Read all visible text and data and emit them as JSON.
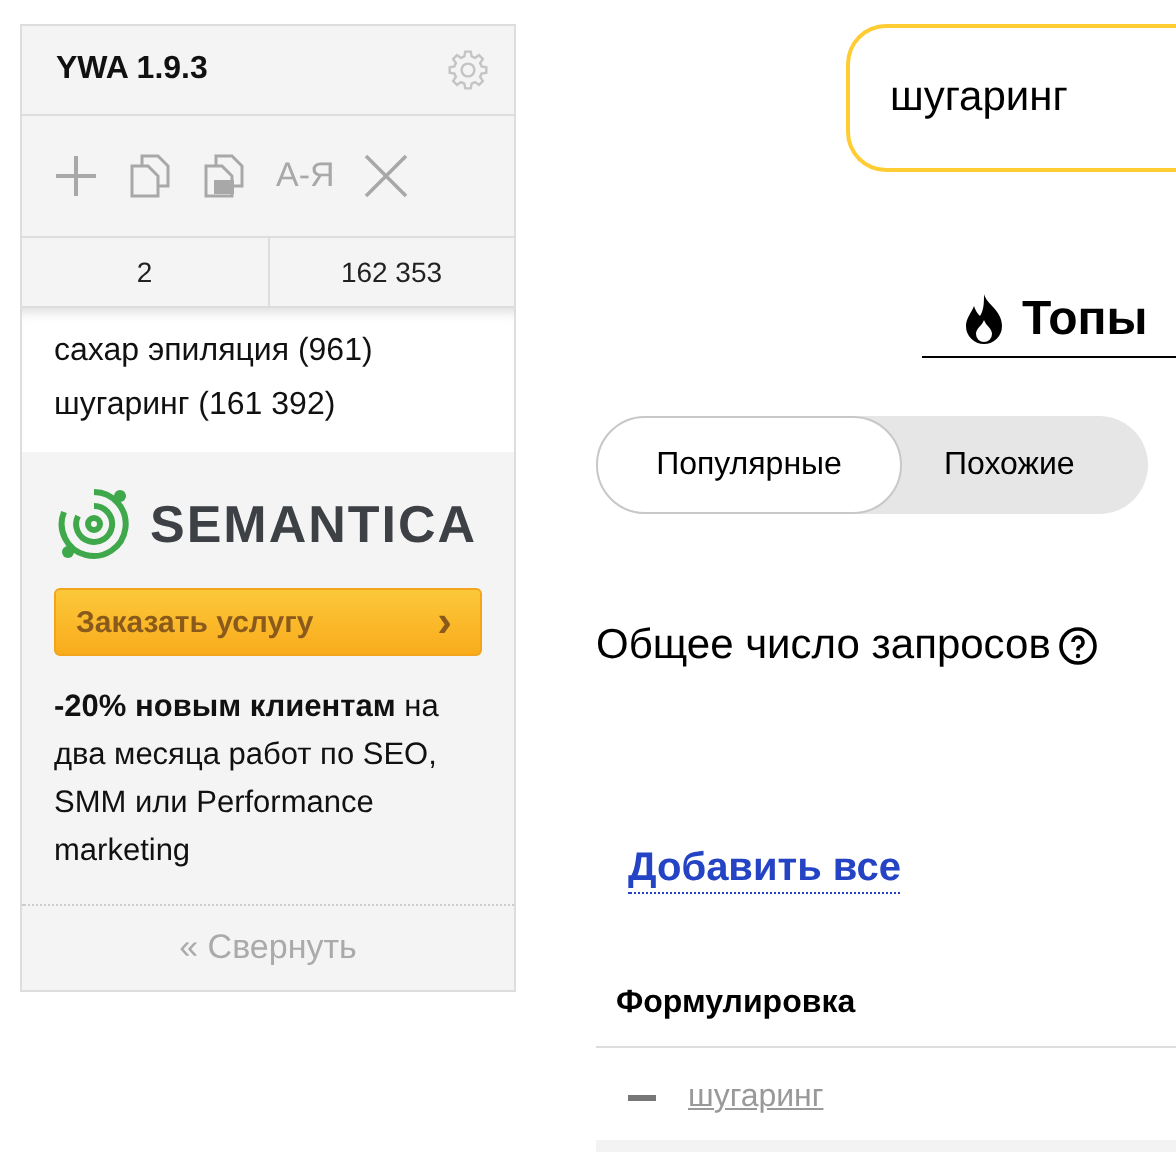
{
  "panel": {
    "title": "YWA 1.9.3",
    "toolbar": [
      {
        "kind": "plus"
      },
      {
        "kind": "copy"
      },
      {
        "kind": "copy-sort"
      },
      {
        "kind": "text",
        "label": "А-Я"
      },
      {
        "kind": "close"
      }
    ],
    "counts": [
      "2",
      "162 353"
    ],
    "keywords": [
      "сахар эпиляция (961)",
      "шугаринг (161 392)"
    ],
    "ad": {
      "brand": "SEMANTICA",
      "button": "Заказать услугу",
      "button_icon": "›",
      "text": "**-20% новым клиентам** на два месяца работ по SEO, SMM или Performance marketing"
    },
    "collapse": "« Свернуть"
  },
  "search": {
    "value": "шугаринг"
  },
  "heading": "Топы",
  "tabs": [
    {
      "label": "Популярные",
      "selected": true
    },
    {
      "label": "Похожие",
      "selected": false
    }
  ],
  "total_label": "Общее число запросов",
  "add_all": "Добавить все",
  "table": {
    "columns": [
      "Формулировка"
    ],
    "rows": [
      {
        "phrase": "шугаринг",
        "added": true
      }
    ]
  }
}
